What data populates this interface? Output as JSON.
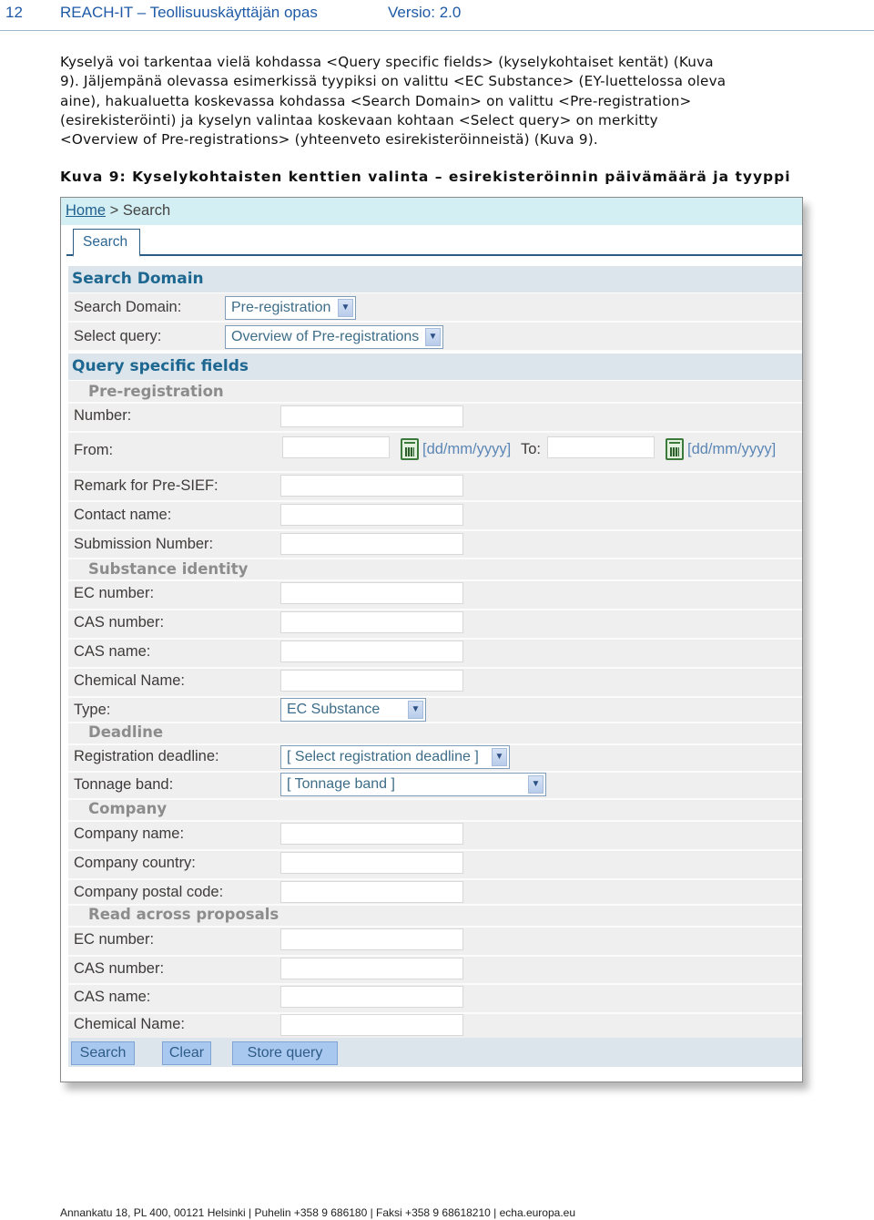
{
  "page_header": {
    "page_number": "12",
    "title": "REACH-IT – Teollisuuskäyttäjän opas",
    "version": "Versio: 2.0"
  },
  "body_text": [
    "Kyselyä voi tarkentaa vielä kohdassa <Query specific fields> (kyselykohtaiset kentät) (Kuva",
    "9). Jäljempänä olevassa esimerkissä tyypiksi on valittu <EC Substance> (EY-luettelossa oleva",
    "aine), hakualuetta koskevassa kohdassa <Search Domain> on valittu <Pre-registration>",
    "(esirekisteröinti) ja kyselyn valintaa koskevaan kohtaan <Select query> on merkitty",
    "<Overview of Pre-registrations> (yhteenveto esirekisteröinneistä) (Kuva 9)."
  ],
  "caption": "Kuva 9: Kyselykohtaisten kenttien valinta – esirekisteröinnin päivämäärä ja tyyppi",
  "screenshot": {
    "breadcrumb": {
      "home": "Home",
      "separator": ">",
      "current": "Search"
    },
    "tab": "Search",
    "search_domain_section": {
      "title": "Search Domain",
      "search_domain_label": "Search Domain:",
      "search_domain_value": "Pre-registration",
      "select_query_label": "Select query:",
      "select_query_value": "Overview of Pre-registrations"
    },
    "query_fields_section": {
      "title": "Query specific fields",
      "pre_registration": {
        "title": "Pre-registration",
        "number_label": "Number:",
        "from_label": "From:",
        "date_format": "[dd/mm/yyyy]",
        "to_label": "To:",
        "remark_label": "Remark for Pre-SIEF:",
        "contact_label": "Contact name:",
        "submission_label": "Submission Number:"
      },
      "substance_identity": {
        "title": "Substance identity",
        "ec_label": "EC number:",
        "cas_number_label": "CAS number:",
        "cas_name_label": "CAS name:",
        "chemical_label": "Chemical Name:",
        "type_label": "Type:",
        "type_value": "EC Substance"
      },
      "deadline": {
        "title": "Deadline",
        "registration_label": "Registration deadline:",
        "registration_value": "[ Select registration deadline ]",
        "tonnage_label": "Tonnage band:",
        "tonnage_value": "[ Tonnage band ]"
      },
      "company": {
        "title": "Company",
        "name_label": "Company name:",
        "country_label": "Company country:",
        "postal_label": "Company postal code:"
      },
      "read_across": {
        "title": "Read across proposals",
        "ec_label": "EC number:",
        "cas_number_label": "CAS number:",
        "cas_name_label": "CAS name:",
        "chemical_label": "Chemical Name:"
      }
    },
    "buttons": {
      "search": "Search",
      "clear": "Clear",
      "store": "Store query"
    },
    "dropdown_arrow": "▼"
  },
  "footer": "Annankatu 18, PL 400, 00121 Helsinki | Puhelin +358 9 686180 | Faksi +358 9 68618210 | echa.europa.eu"
}
